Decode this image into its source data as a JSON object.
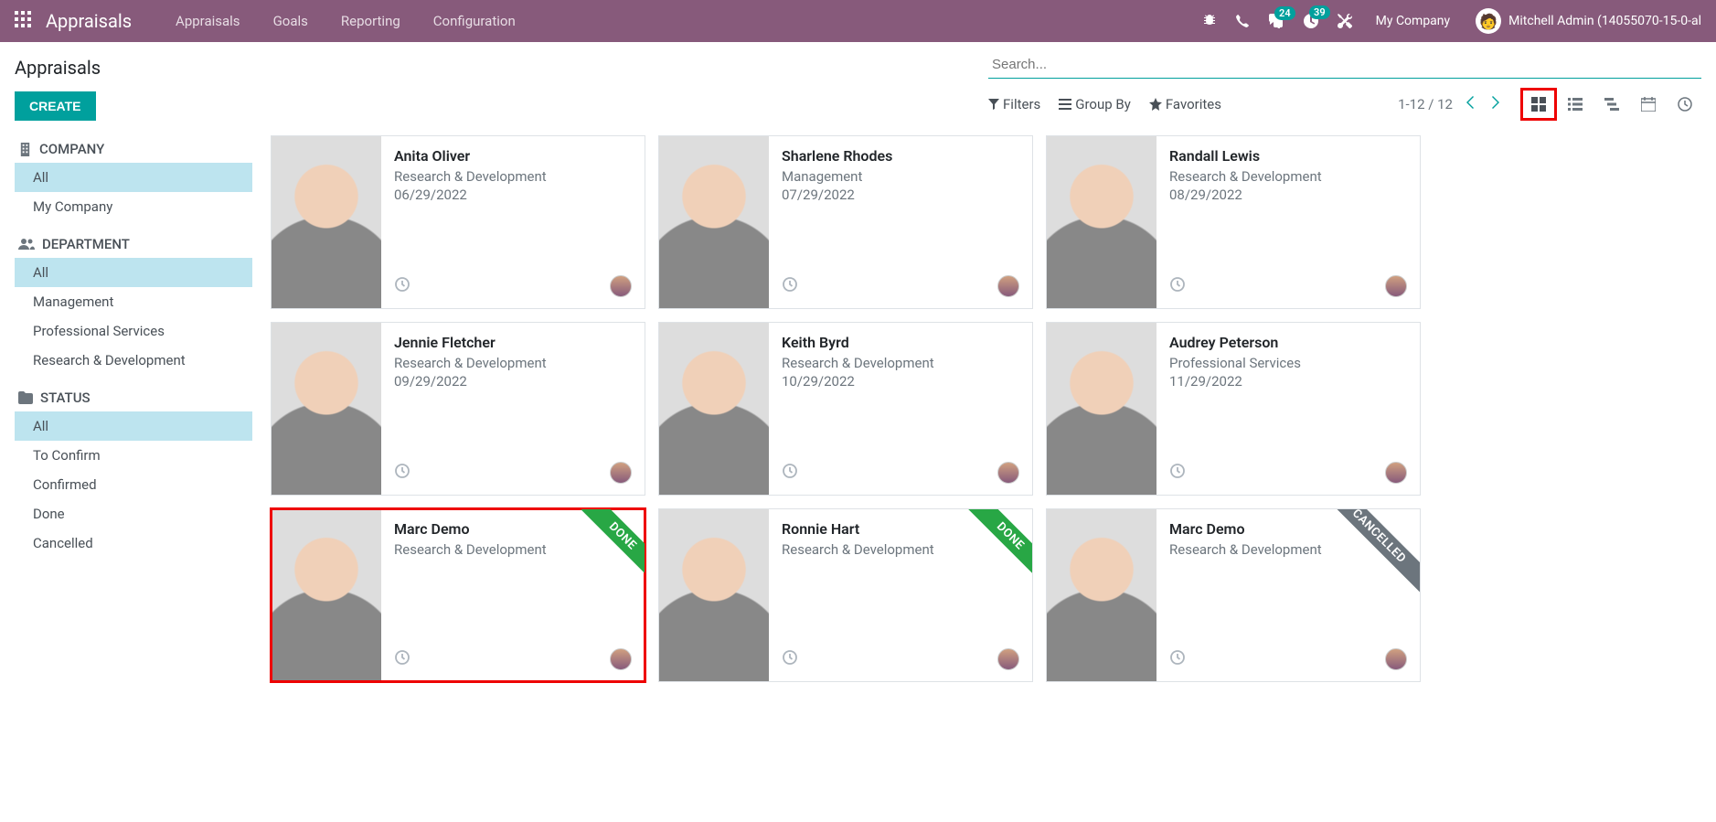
{
  "topnav": {
    "brand": "Appraisals",
    "menu": [
      "Appraisals",
      "Goals",
      "Reporting",
      "Configuration"
    ],
    "msg_badge": "24",
    "activity_badge": "39",
    "company": "My Company",
    "user": "Mitchell Admin (14055070-15-0-al"
  },
  "cp": {
    "title": "Appraisals",
    "create": "CREATE",
    "search_placeholder": "Search...",
    "filters": "Filters",
    "groupby": "Group By",
    "favorites": "Favorites",
    "pager": "1-12 / 12"
  },
  "sidebar": {
    "sections": [
      {
        "title": "COMPANY",
        "icon": "building",
        "items": [
          {
            "label": "All",
            "active": true
          },
          {
            "label": "My Company"
          }
        ]
      },
      {
        "title": "DEPARTMENT",
        "icon": "users",
        "items": [
          {
            "label": "All",
            "active": true
          },
          {
            "label": "Management"
          },
          {
            "label": "Professional Services"
          },
          {
            "label": "Research & Development"
          }
        ]
      },
      {
        "title": "STATUS",
        "icon": "folder",
        "items": [
          {
            "label": "All",
            "active": true
          },
          {
            "label": "To Confirm"
          },
          {
            "label": "Confirmed"
          },
          {
            "label": "Done"
          },
          {
            "label": "Cancelled"
          }
        ]
      }
    ]
  },
  "cards": [
    {
      "name": "Anita Oliver",
      "dept": "Research & Development",
      "date": "06/29/2022"
    },
    {
      "name": "Sharlene Rhodes",
      "dept": "Management",
      "date": "07/29/2022"
    },
    {
      "name": "Randall Lewis",
      "dept": "Research & Development",
      "date": "08/29/2022"
    },
    {
      "name": "Jennie Fletcher",
      "dept": "Research & Development",
      "date": "09/29/2022"
    },
    {
      "name": "Keith Byrd",
      "dept": "Research & Development",
      "date": "10/29/2022"
    },
    {
      "name": "Audrey Peterson",
      "dept": "Professional Services",
      "date": "11/29/2022"
    },
    {
      "name": "Marc Demo",
      "dept": "Research & Development",
      "date": "",
      "ribbon": "DONE",
      "ribbon_cls": "done",
      "highlight": true
    },
    {
      "name": "Ronnie Hart",
      "dept": "Research & Development",
      "date": "",
      "ribbon": "DONE",
      "ribbon_cls": "done"
    },
    {
      "name": "Marc Demo",
      "dept": "Research & Development",
      "date": "",
      "ribbon": "CANCELLED",
      "ribbon_cls": "cancelled"
    }
  ]
}
